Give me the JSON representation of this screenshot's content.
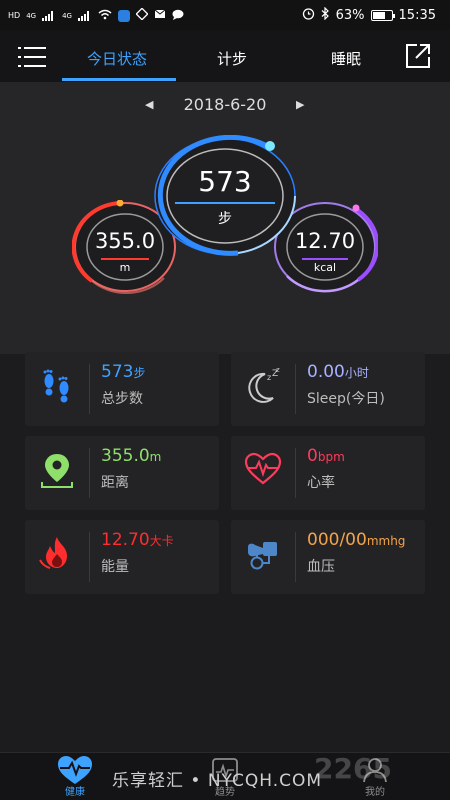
{
  "status_bar": {
    "net1": "HD",
    "net1_sup": "4G",
    "net2_sup": "4G",
    "battery": "63%",
    "time": "15:35"
  },
  "header": {
    "tabs": [
      {
        "label": "今日状态",
        "active": true
      },
      {
        "label": "计步",
        "active": false
      },
      {
        "label": "睡眠",
        "active": false
      }
    ]
  },
  "date": "2018-6-20",
  "rings": {
    "steps": {
      "value": "573",
      "unit": "步"
    },
    "distance": {
      "value": "355.0",
      "unit": "m"
    },
    "calories": {
      "value": "12.70",
      "unit": "kcal"
    }
  },
  "cards": [
    {
      "value": "573",
      "unit": "步",
      "label": "总步数",
      "color": "#3ea2ff",
      "icon": "footprints-icon"
    },
    {
      "value": "0.00",
      "unit": "小时",
      "label": "Sleep(今日)",
      "color": "#a8b1ff",
      "icon": "moon-sleep-icon"
    },
    {
      "value": "355.0",
      "unit": "m",
      "label": "距离",
      "color": "#8ee06a",
      "icon": "location-pin-icon"
    },
    {
      "value": "0",
      "unit": "bpm",
      "label": "心率",
      "color": "#ff3b5c",
      "icon": "heartbeat-icon"
    },
    {
      "value": "12.70",
      "unit": "大卡",
      "label": "能量",
      "color": "#ff2d2d",
      "icon": "flame-icon"
    },
    {
      "value": "000/00",
      "unit": "mmhg",
      "label": "血压",
      "color": "#f2a34a",
      "icon": "blood-pressure-icon"
    }
  ],
  "bottom_nav": [
    {
      "label": "健康",
      "active": true,
      "icon": "heart-pulse-icon"
    },
    {
      "label": "趋势",
      "active": false,
      "icon": "trend-icon"
    },
    {
      "label": "我的",
      "active": false,
      "icon": "person-icon"
    }
  ],
  "watermark": {
    "text": "乐享轻汇 • NYCQH.COM",
    "logo": "2265"
  },
  "colors": {
    "accent": "#3ea2ff",
    "distance_ring": "#ff3b30",
    "calorie_ring": "#9b4dff"
  }
}
